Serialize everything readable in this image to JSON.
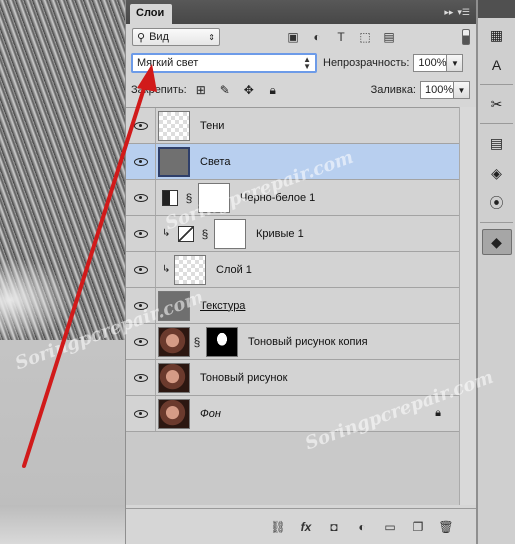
{
  "panel": {
    "title": "Слои",
    "filter_label": "Вид",
    "blend_mode": "Мягкий свет",
    "opacity_label": "Непрозрачность:",
    "opacity_value": "100%",
    "lock_label": "Закрепить:",
    "fill_label": "Заливка:",
    "fill_value": "100%"
  },
  "layers": [
    {
      "name": "Тени",
      "style": "normal"
    },
    {
      "name": "Света",
      "style": "normal"
    },
    {
      "name": "Черно-белое 1",
      "style": "normal"
    },
    {
      "name": "Кривые 1",
      "style": "normal"
    },
    {
      "name": "Слой 1",
      "style": "normal"
    },
    {
      "name": "Текстура",
      "style": "underlined"
    },
    {
      "name": "Тоновый рисунок копия",
      "style": "normal"
    },
    {
      "name": "Тоновый рисунок",
      "style": "normal"
    },
    {
      "name": "Фон",
      "style": "italic"
    }
  ],
  "watermark": "Soringpcrepair.com",
  "colors": {
    "selection": "#b8cfef",
    "arrow": "#d11a1a",
    "focus": "#6d9be8"
  }
}
